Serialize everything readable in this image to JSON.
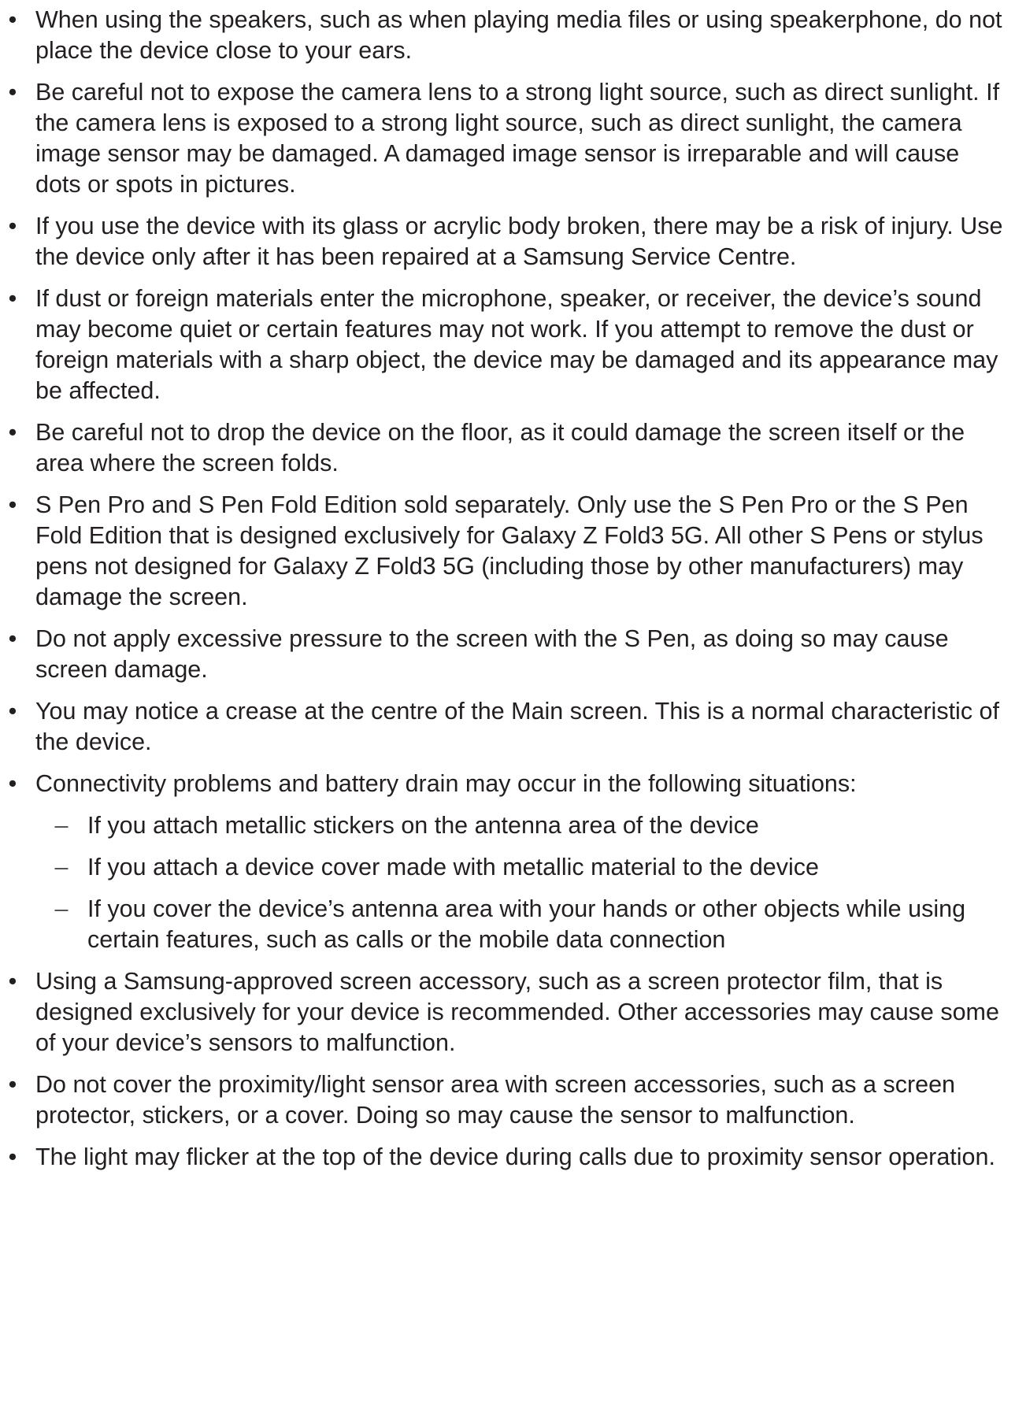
{
  "bullet_symbol": "•",
  "dash_symbol": "–",
  "items": [
    {
      "text": "When using the speakers, such as when playing media files or using speakerphone, do not place the device close to your ears."
    },
    {
      "text": "Be careful not to expose the camera lens to a strong light source, such as direct sunlight. If the camera lens is exposed to a strong light source, such as direct sunlight, the camera image sensor may be damaged. A damaged image sensor is irreparable and will cause dots or spots in pictures."
    },
    {
      "text": "If you use the device with its glass or acrylic body broken, there may be a risk of injury. Use the device only after it has been repaired at a Samsung Service Centre."
    },
    {
      "text": "If dust or foreign materials enter the microphone, speaker, or receiver, the device’s sound may become quiet or certain features may not work. If you attempt to remove the dust or foreign materials with a sharp object, the device may be damaged and its appearance may be affected."
    },
    {
      "text": "Be careful not to drop the device on the floor, as it could damage the screen itself or the area where the screen folds."
    },
    {
      "text": "S Pen Pro and S Pen Fold Edition sold separately. Only use the S Pen Pro or the S Pen Fold Edition that is designed exclusively for Galaxy Z Fold3 5G. All other S Pens or stylus pens not designed for Galaxy Z Fold3 5G (including those by other manufacturers) may damage the screen."
    },
    {
      "text": "Do not apply excessive pressure to the screen with the S Pen, as doing so may cause screen damage."
    },
    {
      "text": "You may notice a crease at the centre of the Main screen. This is a normal characteristic of the device."
    },
    {
      "text": "Connectivity problems and battery drain may occur in the following situations:",
      "subitems": [
        "If you attach metallic stickers on the antenna area of the device",
        "If you attach a device cover made with metallic material to the device",
        "If you cover the device’s antenna area with your hands or other objects while using certain features, such as calls or the mobile data connection"
      ]
    },
    {
      "text": "Using a Samsung-approved screen accessory, such as a screen protector film, that is designed exclusively for your device is recommended. Other accessories may cause some of your device’s sensors to malfunction."
    },
    {
      "text": "Do not cover the proximity/light sensor area with screen accessories, such as a screen protector, stickers, or a cover. Doing so may cause the sensor to malfunction."
    },
    {
      "text": "The light may flicker at the top of the device during calls due to proximity sensor operation."
    }
  ]
}
